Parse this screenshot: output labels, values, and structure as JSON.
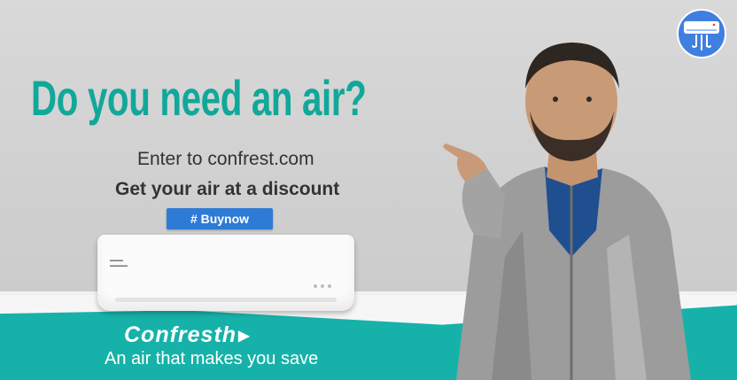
{
  "ad": {
    "headline": "Do you need an air?",
    "line1": "Enter to confrest.com",
    "line2": "Get your air at a discount",
    "cta": "# Buynow",
    "brand": "Confresth",
    "slogan": "An air that makes you save"
  },
  "colors": {
    "headline": "#11a89a",
    "teal_band": "#16b2a9",
    "cta_bg": "#2e7bd6",
    "logo_bg": "#3f7fe0"
  },
  "icons": [
    "air-conditioner-logo-icon",
    "arrow-right-icon"
  ]
}
